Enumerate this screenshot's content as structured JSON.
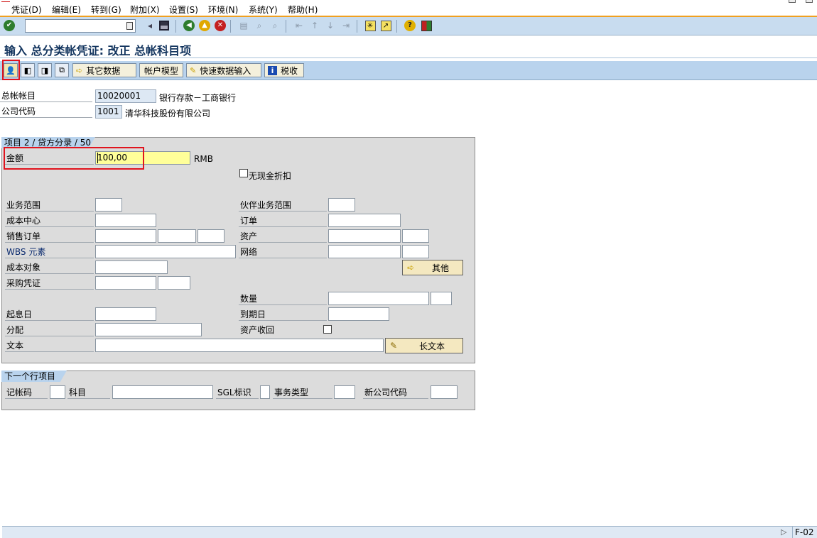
{
  "menu": [
    "凭证(D)",
    "编辑(E)",
    "转到(G)",
    "附加(X)",
    "设置(S)",
    "环境(N)",
    "系统(Y)",
    "帮助(H)"
  ],
  "title": "输入 总分类帐凭证: 改正 总帐科目项",
  "app_toolbar": {
    "other_data": "其它数据",
    "account_model": "帐户模型",
    "fast_entry": "快速数据输入",
    "tax": "税收"
  },
  "header": {
    "gl_account_label": "总帐帐目",
    "gl_account_value": "10020001",
    "gl_account_desc": "银行存款－工商银行",
    "company_code_label": "公司代码",
    "company_code_value": "1001",
    "company_code_desc": "清华科技股份有限公司"
  },
  "item_group": {
    "title": "项目 2 / 贷方分录 / 50",
    "amount_label": "金额",
    "amount_value": "100,00",
    "currency": "RMB",
    "no_cash_discount": "无现金折扣",
    "business_area": "业务范围",
    "trading_partner_ba": "伙伴业务范围",
    "cost_center": "成本中心",
    "order": "订单",
    "sales_order": "销售订单",
    "asset": "资产",
    "wbs_element": "WBS 元素",
    "network": "网络",
    "cost_object": "成本对象",
    "more_button": "其他",
    "purchasing_doc": "采购凭证",
    "quantity": "数量",
    "value_date": "起息日",
    "due_on": "到期日",
    "assignment": "分配",
    "asset_retirement": "资产收回",
    "text": "文本",
    "long_text_button": "长文本"
  },
  "next_item": {
    "title": "下一个行项目",
    "posting_key": "记帐码",
    "account": "科目",
    "sgl_indicator": "SGL标识",
    "transaction_type": "事务类型",
    "new_company_code": "新公司代码"
  },
  "status": {
    "transaction": "F-02"
  }
}
